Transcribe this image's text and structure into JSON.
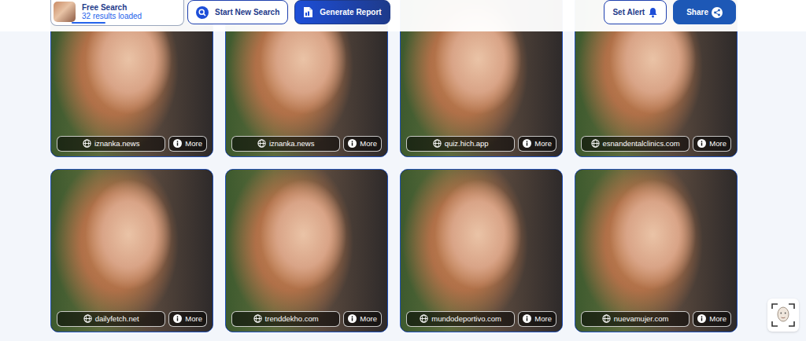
{
  "search": {
    "mode": "Free Search",
    "count": "32 results loaded",
    "progress": 0.35
  },
  "toolbar": {
    "new_search": "Start New Search",
    "report": "Generate Report",
    "alert": "Set Alert",
    "share": "Share"
  },
  "results": [
    {
      "domain": "iznanka.news",
      "more": "More"
    },
    {
      "domain": "iznanka.news",
      "more": "More"
    },
    {
      "domain": "quiz.hich.app",
      "more": "More"
    },
    {
      "domain": "esnandentalclinics.com",
      "more": "More"
    },
    {
      "domain": "dailyfetch.net",
      "more": "More"
    },
    {
      "domain": "trenddekho.com",
      "more": "More"
    },
    {
      "domain": "mundodeportivo.com",
      "more": "More"
    },
    {
      "domain": "nuevamujer.com",
      "more": "More"
    }
  ]
}
